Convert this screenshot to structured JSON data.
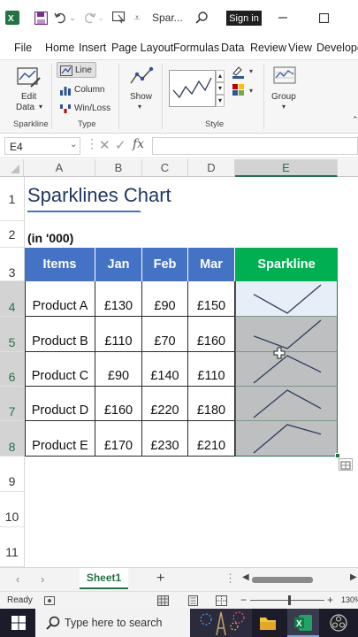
{
  "titlebar": {
    "doc_title": "Spar...",
    "signin_label": "Sign in"
  },
  "menu": [
    "File",
    "Home",
    "Insert",
    "Page Layout",
    "Formulas",
    "Data",
    "Review",
    "View",
    "Develope"
  ],
  "ribbon": {
    "edit_data_line1": "Edit",
    "edit_data_line2": "Data",
    "group_sparkline": "Sparkline",
    "type_line": "Line",
    "type_column": "Column",
    "type_winloss": "Win/Loss",
    "group_type": "Type",
    "show_label": "Show",
    "group_style": "Style",
    "group_label": "Group"
  },
  "formula_bar": {
    "name_box": "E4",
    "fx": "fx",
    "value": ""
  },
  "columns": [
    "A",
    "B",
    "C",
    "D",
    "E"
  ],
  "rows": [
    "1",
    "2",
    "3",
    "4",
    "5",
    "6",
    "7",
    "8",
    "9",
    "10",
    "11"
  ],
  "sheet": {
    "title": "Sparklines Chart",
    "subtitle": "(in '000)",
    "headers": [
      "Items",
      "Jan",
      "Feb",
      "Mar",
      "Sparkline"
    ],
    "data": [
      {
        "item": "Product A",
        "jan": "£130",
        "feb": "£90",
        "mar": "£150"
      },
      {
        "item": "Product B",
        "jan": "£110",
        "feb": "£70",
        "mar": "£160"
      },
      {
        "item": "Product C",
        "jan": "£90",
        "feb": "£140",
        "mar": "£110"
      },
      {
        "item": "Product D",
        "jan": "£160",
        "feb": "£220",
        "mar": "£180"
      },
      {
        "item": "Product E",
        "jan": "£170",
        "feb": "£230",
        "mar": "£210"
      }
    ]
  },
  "sparkline_values": [
    [
      130,
      90,
      150
    ],
    [
      110,
      70,
      160
    ],
    [
      90,
      140,
      110
    ],
    [
      160,
      220,
      180
    ],
    [
      170,
      230,
      210
    ]
  ],
  "tabs": {
    "sheet1": "Sheet1"
  },
  "status": {
    "ready": "Ready",
    "zoom": "130%"
  },
  "taskbar": {
    "search_placeholder": "Type here to search"
  },
  "colors": {
    "header_blue": "#4472c4",
    "sparkline_green": "#00b050",
    "sparkline_stroke": "#2e3c5a",
    "excel_green": "#217346"
  }
}
